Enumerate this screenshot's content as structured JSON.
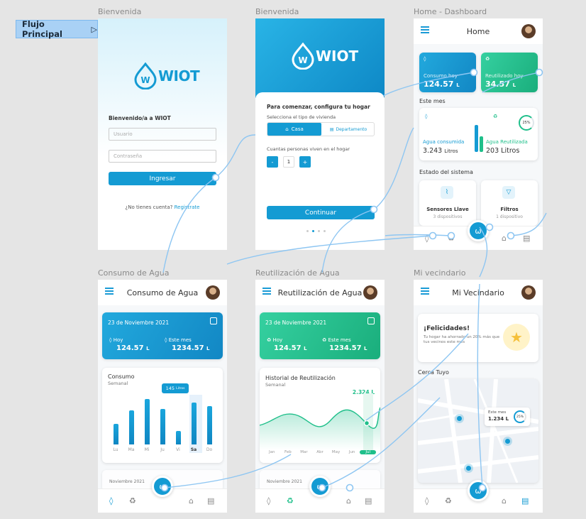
{
  "flow": {
    "label": "Flujo Principal",
    "icon": "play-outline-icon"
  },
  "frames": {
    "login_title": "Bienvenida",
    "setup_title": "Bienvenida",
    "home_title": "Home - Dashboard",
    "consumo_title": "Consumo de Agua",
    "reutil_title": "Reutilización de Agua",
    "vecindario_title": "Mi vecindario"
  },
  "brand": {
    "logo_text": "WIOT"
  },
  "login": {
    "welcome": "Bienvenido/a a WIOT",
    "user_placeholder": "Usuario",
    "pass_placeholder": "Contraseña",
    "login_button": "Ingresar",
    "no_account": "¿No tienes cuenta?",
    "register_link": "Registrate"
  },
  "setup": {
    "heading": "Para comenzar, configura tu hogar",
    "select_label": "Selecciona el tipo de vivienda",
    "option_house": "Casa",
    "option_apartment": "Departamento",
    "people_label": "Cuantas personas viven en el hogar",
    "minus": "-",
    "count": "1",
    "plus": "+",
    "continue_button": "Continuar"
  },
  "home": {
    "header": "Home",
    "card1_label": "Consumo hoy",
    "card1_value": "124.57",
    "card1_unit": "L",
    "card2_label": "Reutilizado hoy",
    "card2_value": "34.57",
    "card2_unit": "L",
    "month_label": "Este mes",
    "consumed_label": "Agua consumida",
    "consumed_value": "3.243",
    "consumed_unit": "Litros",
    "reused_label": "Agua Reutilizada",
    "reused_value": "203",
    "reused_unit": "Litros",
    "ring_label": "25%",
    "system_label": "Estado del sistema",
    "sensors_label": "Sensores Llave",
    "sensors_sub": "3 dispositivos",
    "filters_label": "Filtros",
    "filters_sub": "1 dispositivo"
  },
  "consumo": {
    "header": "Consumo de Agua",
    "date": "23 de Noviembre 2021",
    "today_label": "Hoy",
    "today_value": "124.57",
    "today_unit": "L",
    "month_label": "Este mes",
    "month_value": "1234.57",
    "month_unit": "L",
    "chart_title": "Consumo",
    "chart_period": "Semanal",
    "tooltip": "145",
    "tooltip_unit": "Litros",
    "days": [
      "Lu",
      "Ma",
      "Mi",
      "Ju",
      "Vi",
      "Sa",
      "Do"
    ],
    "next_month": "Noviembre 2021"
  },
  "reutil": {
    "header": "Reutilización de Agua",
    "date": "23 de Noviembre 2021",
    "today_label": "Hoy",
    "today_value": "124.57",
    "today_unit": "L",
    "month_label": "Este mes",
    "month_value": "1234.57",
    "month_unit": "L",
    "chart_title": "Historial de Reutilización",
    "chart_period": "Semanal",
    "chart_value": "2.324 L",
    "months": [
      "Jan",
      "Feb",
      "Mar",
      "Abr",
      "May",
      "Jun",
      "Jul"
    ],
    "next_month": "Noviembre 2021"
  },
  "vecindario": {
    "header": "Mi Vecindario",
    "congrats_title": "¡Felicidades!",
    "congrats_body": "Tu hogar ha ahorrado un 20% más que tus vecinos este mes",
    "near_label": "Cerca Tuyo",
    "pin_label": "Este mes",
    "pin_value": "1.234 L",
    "pin_ring": "25%"
  },
  "icons": {
    "fab": "wiot-logo-icon",
    "nav": [
      "drop-icon",
      "recycle-icon",
      "home-icon",
      "building-icon"
    ]
  },
  "colors": {
    "primary": "#149bd3",
    "green": "#1fbf8a",
    "flow_line": "#8ec6f2",
    "flow_bg": "#a9d1f5"
  },
  "chart_data": {
    "type": "bar",
    "categories": [
      "Lu",
      "Ma",
      "Mi",
      "Ju",
      "Vi",
      "Sa",
      "Do"
    ],
    "values": [
      45,
      75,
      100,
      78,
      30,
      92,
      85
    ],
    "ylim": [
      0,
      110
    ],
    "highlighted": "Sa"
  }
}
